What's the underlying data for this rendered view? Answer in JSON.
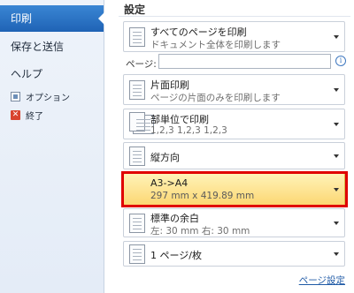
{
  "nav": {
    "print": "印刷",
    "save_send": "保存と送信",
    "help": "ヘルプ",
    "options": "オプション",
    "exit": "終了"
  },
  "settings": {
    "title": "設定",
    "print_scope": {
      "title": "すべてのページを印刷",
      "subtitle": "ドキュメント全体を印刷します"
    },
    "pages_label": "ページ:",
    "pages_value": "",
    "sides": {
      "title": "片面印刷",
      "subtitle": "ページの片面のみを印刷します"
    },
    "collate": {
      "title": "部単位で印刷",
      "subtitle": "1,2,3    1,2,3    1,2,3"
    },
    "orientation": {
      "title": "縦方向"
    },
    "paper": {
      "title": "A3->A4",
      "subtitle": "297 mm x 419.89 mm"
    },
    "margins": {
      "title": "標準の余白",
      "subtitle": "左: 30 mm    右: 30 mm"
    },
    "pages_per_sheet": {
      "title": "1 ページ/枚"
    },
    "page_setup_link": "ページ設定"
  },
  "icons": {
    "info": "i",
    "exit": "✕"
  },
  "colors": {
    "nav_active": "#1f63b5",
    "highlight": "#fcd773",
    "annotation": "#e00000"
  }
}
